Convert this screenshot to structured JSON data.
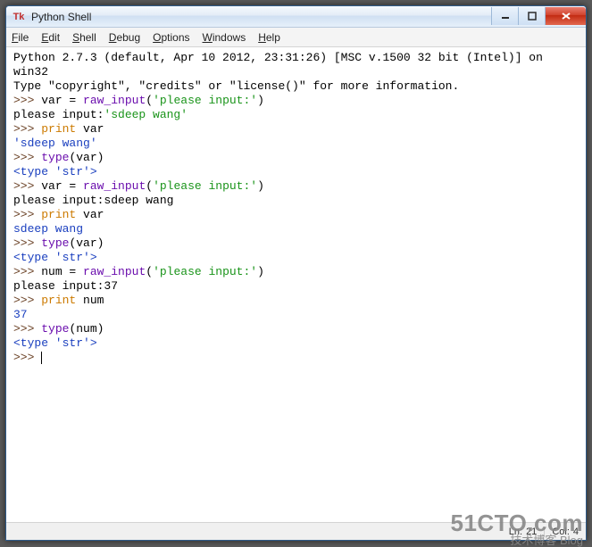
{
  "window": {
    "title": "Python Shell",
    "icon_label": "Tk"
  },
  "menu": {
    "items": [
      {
        "accel": "F",
        "rest": "ile"
      },
      {
        "accel": "E",
        "rest": "dit"
      },
      {
        "accel": "S",
        "rest": "hell"
      },
      {
        "accel": "D",
        "rest": "ebug"
      },
      {
        "accel": "O",
        "rest": "ptions"
      },
      {
        "accel": "W",
        "rest": "indows"
      },
      {
        "accel": "H",
        "rest": "elp"
      }
    ]
  },
  "console": {
    "lines": [
      [
        {
          "class": "c-default",
          "text": "Python 2.7.3 (default, Apr 10 2012, 23:31:26) [MSC v.1500 32 bit (Intel)] on"
        }
      ],
      [
        {
          "class": "c-default",
          "text": "win32"
        }
      ],
      [
        {
          "class": "c-default",
          "text": "Type \"copyright\", \"credits\" or \"license()\" for more information."
        }
      ],
      [
        {
          "class": "c-prompt",
          "text": ">>> "
        },
        {
          "class": "c-default",
          "text": "var = "
        },
        {
          "class": "c-builtin",
          "text": "raw_input"
        },
        {
          "class": "c-default",
          "text": "("
        },
        {
          "class": "c-string",
          "text": "'please input:'"
        },
        {
          "class": "c-default",
          "text": ")"
        }
      ],
      [
        {
          "class": "c-default",
          "text": "please input:"
        },
        {
          "class": "c-string",
          "text": "'sdeep wang'"
        }
      ],
      [
        {
          "class": "c-prompt",
          "text": ">>> "
        },
        {
          "class": "c-keyword",
          "text": "print"
        },
        {
          "class": "c-default",
          "text": " var"
        }
      ],
      [
        {
          "class": "c-output",
          "text": "'sdeep wang'"
        }
      ],
      [
        {
          "class": "c-prompt",
          "text": ">>> "
        },
        {
          "class": "c-builtin",
          "text": "type"
        },
        {
          "class": "c-default",
          "text": "(var)"
        }
      ],
      [
        {
          "class": "c-output",
          "text": "<type 'str'>"
        }
      ],
      [
        {
          "class": "c-prompt",
          "text": ">>> "
        },
        {
          "class": "c-default",
          "text": "var = "
        },
        {
          "class": "c-builtin",
          "text": "raw_input"
        },
        {
          "class": "c-default",
          "text": "("
        },
        {
          "class": "c-string",
          "text": "'please input:'"
        },
        {
          "class": "c-default",
          "text": ")"
        }
      ],
      [
        {
          "class": "c-default",
          "text": "please input:sdeep wang"
        }
      ],
      [
        {
          "class": "c-prompt",
          "text": ">>> "
        },
        {
          "class": "c-keyword",
          "text": "print"
        },
        {
          "class": "c-default",
          "text": " var"
        }
      ],
      [
        {
          "class": "c-output",
          "text": "sdeep wang"
        }
      ],
      [
        {
          "class": "c-prompt",
          "text": ">>> "
        },
        {
          "class": "c-builtin",
          "text": "type"
        },
        {
          "class": "c-default",
          "text": "(var)"
        }
      ],
      [
        {
          "class": "c-output",
          "text": "<type 'str'>"
        }
      ],
      [
        {
          "class": "c-prompt",
          "text": ">>> "
        },
        {
          "class": "c-default",
          "text": "num = "
        },
        {
          "class": "c-builtin",
          "text": "raw_input"
        },
        {
          "class": "c-default",
          "text": "("
        },
        {
          "class": "c-string",
          "text": "'please input:'"
        },
        {
          "class": "c-default",
          "text": ")"
        }
      ],
      [
        {
          "class": "c-default",
          "text": "please input:37"
        }
      ],
      [
        {
          "class": "c-prompt",
          "text": ">>> "
        },
        {
          "class": "c-keyword",
          "text": "print"
        },
        {
          "class": "c-default",
          "text": " num"
        }
      ],
      [
        {
          "class": "c-output",
          "text": "37"
        }
      ],
      [
        {
          "class": "c-prompt",
          "text": ">>> "
        },
        {
          "class": "c-builtin",
          "text": "type"
        },
        {
          "class": "c-default",
          "text": "(num)"
        }
      ],
      [
        {
          "class": "c-output",
          "text": "<type 'str'>"
        }
      ],
      [
        {
          "class": "c-prompt",
          "text": ">>> "
        },
        {
          "class": "c-default",
          "text": "",
          "cursor": true
        }
      ]
    ]
  },
  "statusbar": {
    "line_label": "Ln:",
    "line_value": "21",
    "col_label": "Col:",
    "col_value": "4"
  },
  "watermark": {
    "big": "51CTO.com",
    "small": "技术博客   Blog"
  }
}
